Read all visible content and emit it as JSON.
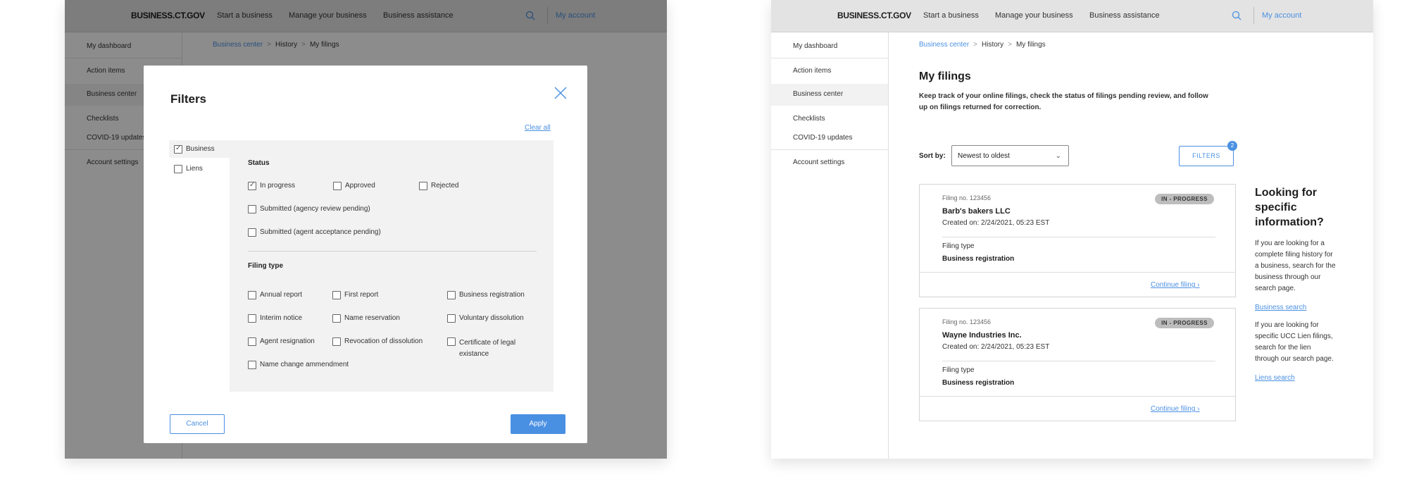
{
  "header": {
    "brand": "BUSINESS.CT.GOV",
    "nav": [
      "Start a business",
      "Manage your business",
      "Business assistance"
    ],
    "account": "My account"
  },
  "sidebar": {
    "items": [
      "My dashboard",
      "Action items",
      "Business center",
      "Checklists",
      "COVID-19 updates",
      "Account settings"
    ],
    "active": "Business center"
  },
  "breadcrumb": [
    "Business center",
    "History",
    "My filings"
  ],
  "page": {
    "title": "My filings",
    "description": "Keep track of your online filings, check the status of filings pending review, and follow up on filings returned for correction."
  },
  "sort": {
    "label": "Sort by:",
    "value": "Newest to oldest"
  },
  "filters_button": {
    "label": "FILTERS",
    "badge": "2"
  },
  "filings": [
    {
      "number": "Filing no. 123456",
      "name": "Barb's bakers LLC",
      "created": "Created on: 2/24/2021, 05:23 EST",
      "status": "IN - PROGRESS",
      "type_label": "Filing type",
      "type": "Business registration",
      "action": "Continue filing"
    },
    {
      "number": "Filing no. 123456",
      "name": "Wayne Industries Inc.",
      "created": "Created on: 2/24/2021, 05:23 EST",
      "status": "IN - PROGRESS",
      "type_label": "Filing type",
      "type": "Business registration",
      "action": "Continue filing"
    }
  ],
  "aside": {
    "title": "Looking for specific information?",
    "text1": "If you are looking for a complete filing history for a business, search for the business through our search page.",
    "link1": "Business search",
    "text2": "If you are looking for specific UCC Lien filings, search for the lien through our search page.",
    "link2": "Liens search"
  },
  "modal": {
    "title": "Filters",
    "clear_all": "Clear all",
    "tabs": [
      {
        "label": "Business",
        "checked": true
      },
      {
        "label": "Liens",
        "checked": false
      }
    ],
    "status_title": "Status",
    "status_options": [
      {
        "label": "In progress",
        "checked": true
      },
      {
        "label": "Approved",
        "checked": false
      },
      {
        "label": "Rejected",
        "checked": false
      },
      {
        "label": "Submitted (agency review pending)",
        "checked": false
      },
      {
        "label": "Submitted (agent acceptance pending)",
        "checked": false
      }
    ],
    "filing_type_title": "Filing type",
    "filing_types": [
      {
        "label": "Annual report",
        "checked": false
      },
      {
        "label": "First report",
        "checked": false
      },
      {
        "label": "Business registration",
        "checked": false
      },
      {
        "label": "Interim notice",
        "checked": false
      },
      {
        "label": "Name reservation",
        "checked": false
      },
      {
        "label": "Voluntary dissolution",
        "checked": false
      },
      {
        "label": "Agent resignation",
        "checked": false
      },
      {
        "label": "Revocation of dissolution",
        "checked": false
      },
      {
        "label": "Certificate of legal existance",
        "checked": false
      },
      {
        "label": "Name change ammendment",
        "checked": false
      }
    ],
    "cancel": "Cancel",
    "apply": "Apply"
  },
  "colors": {
    "accent": "#4a90e2",
    "nav_bg": "#e3e3e3",
    "panel_bg": "#f2f2f2",
    "status_badge": "#bdbdbd"
  }
}
